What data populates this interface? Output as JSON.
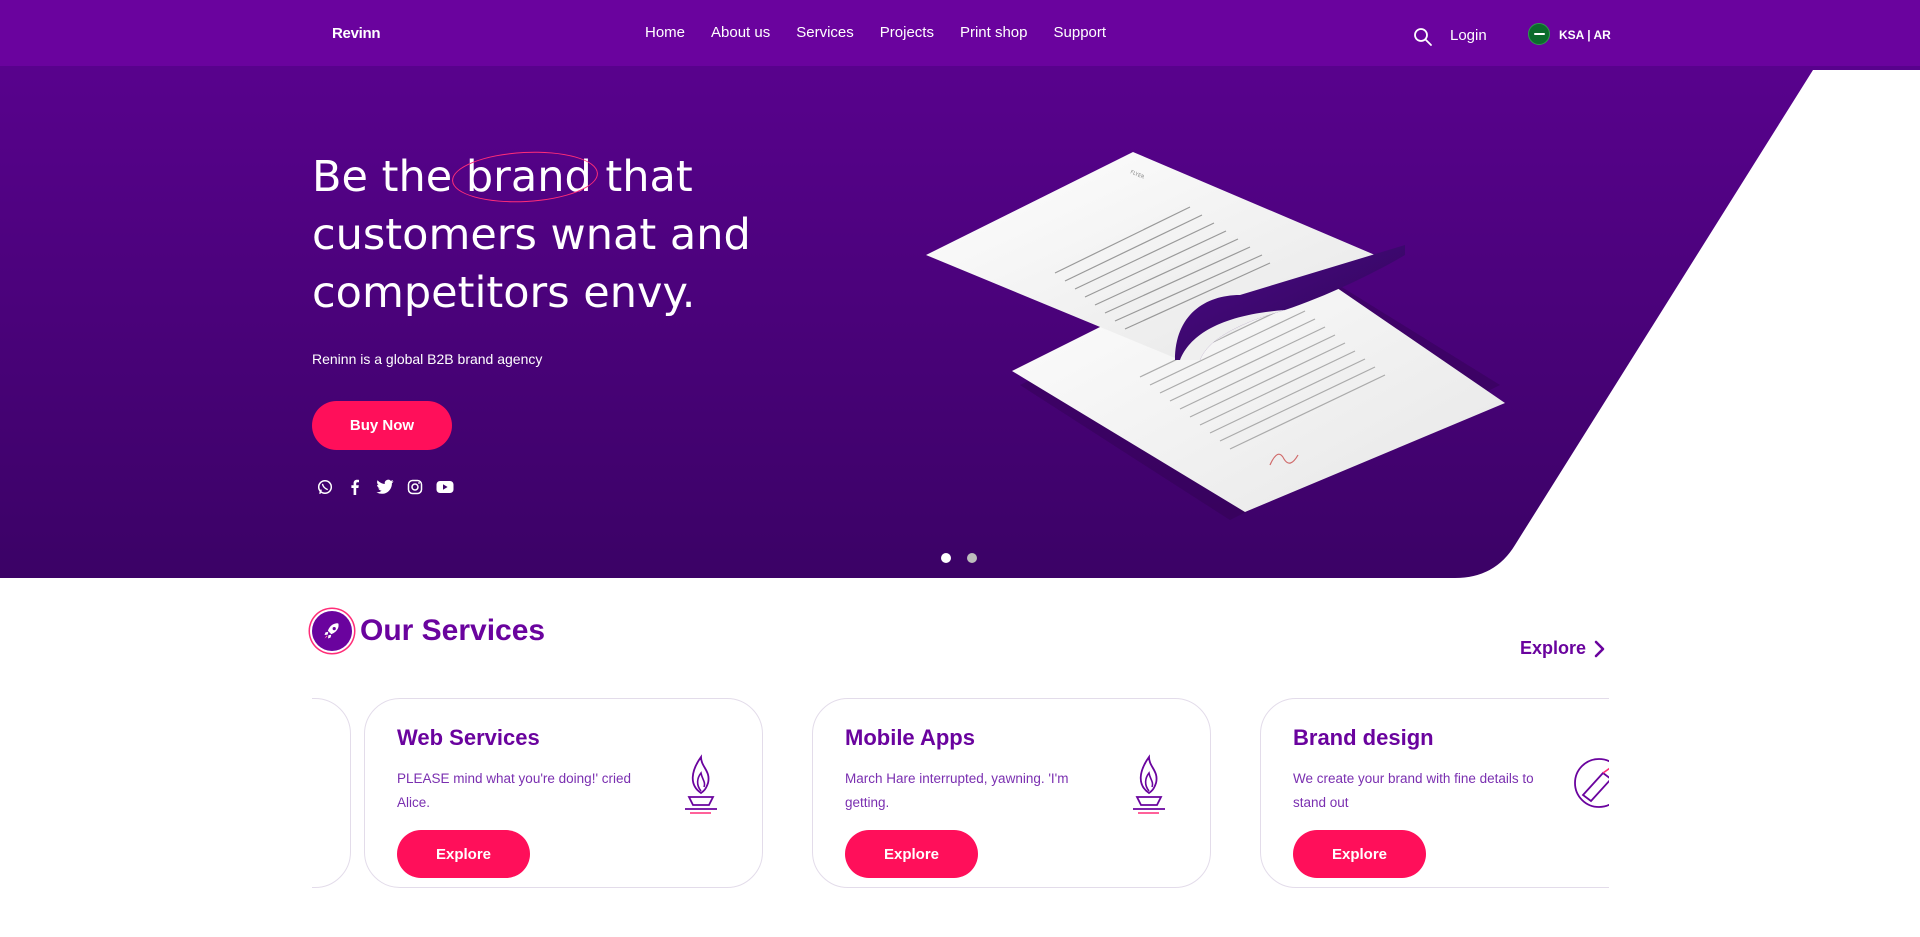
{
  "nav": {
    "logo": "Revinn",
    "items": [
      "Home",
      "About us",
      "Services",
      "Projects",
      "Print shop",
      "Support"
    ],
    "login": "Login",
    "lang": "KSA | AR",
    "search_icon": "search-icon",
    "flag_icon": "saudi-flag-icon"
  },
  "hero": {
    "title_pre": "Be the",
    "title_highlight": "brand",
    "title_post": "that",
    "title_line2": "customers wnat and",
    "title_line3": "competitors envy.",
    "subtitle": "Reninn is a global B2B brand agency",
    "cta": "Buy Now",
    "socials": [
      "whatsapp-icon",
      "facebook-icon",
      "twitter-icon",
      "instagram-icon",
      "youtube-icon"
    ],
    "slides": 2,
    "active_slide": 1
  },
  "services": {
    "title": "Our Services",
    "explore": "Explore",
    "cards": [
      {
        "title": "Web Services",
        "desc": "PLEASE mind what you're doing!' cried Alice.",
        "button": "Explore",
        "icon": "torch-icon"
      },
      {
        "title": "Mobile Apps",
        "desc": "March Hare interrupted, yawning. 'I'm getting.",
        "button": "Explore",
        "icon": "torch-icon"
      },
      {
        "title": "Brand design",
        "desc": "We create your brand with fine details to stand out",
        "button": "Explore",
        "icon": "pen-icon"
      }
    ]
  },
  "colors": {
    "primary": "#6a039e",
    "accent": "#ff0f5a",
    "hero_dark": "#3b0266"
  }
}
